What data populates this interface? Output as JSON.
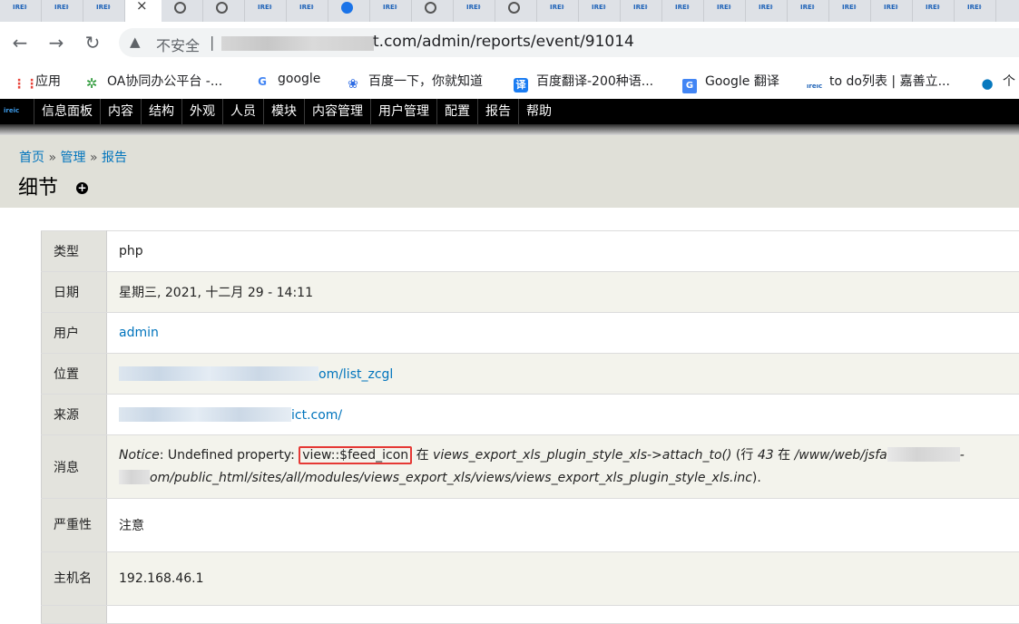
{
  "browser": {
    "tab_favicon_text": "IREIC",
    "tab_close_glyph": "×",
    "nav": {
      "back": "←",
      "forward": "→",
      "reload": "↻"
    },
    "address": {
      "warning_icon": "▲",
      "insecure_label": "不安全",
      "separator": "|",
      "url_visible": "t.com/admin/reports/event/91014"
    },
    "bookmarks": [
      {
        "icon": "apps-grid-icon",
        "label": "应用"
      },
      {
        "icon": "oa-icon",
        "label": "OA协同办公平台 -..."
      },
      {
        "icon": "google-icon",
        "label": "google"
      },
      {
        "icon": "baidu-icon",
        "label": "百度一下，你就知道"
      },
      {
        "icon": "translate-icon",
        "label": "百度翻译-200种语..."
      },
      {
        "icon": "google-translate-icon",
        "label": "Google 翻译"
      },
      {
        "icon": "ireic-icon",
        "label": "to do列表 | 嘉善立..."
      },
      {
        "icon": "drupal-icon",
        "label": "个"
      }
    ]
  },
  "admin_menu": {
    "logo": "ireic",
    "items": [
      "信息面板",
      "内容",
      "结构",
      "外观",
      "人员",
      "模块",
      "内容管理",
      "用户管理",
      "配置",
      "报告",
      "帮助"
    ]
  },
  "breadcrumb": {
    "home": "首页",
    "admin": "管理",
    "reports": "报告",
    "sep": "»"
  },
  "page_title": "细节",
  "details": {
    "type_label": "类型",
    "type_value": "php",
    "date_label": "日期",
    "date_value": "星期三, 2021, 十二月 29 - 14:11",
    "user_label": "用户",
    "user_value": "admin",
    "location_label": "位置",
    "location_value_suffix": "om/list_zcgl",
    "referrer_label": "来源",
    "referrer_value_suffix": "ict.com/",
    "message_label": "消息",
    "message": {
      "notice": "Notice",
      "text1": ": Undefined property: ",
      "highlight": "view::$feed_icon",
      "in1": " 在 ",
      "func": "views_export_xls_plugin_style_xls->attach_to()",
      "line_open": " (行 ",
      "line_no": "43",
      "in2": " 在 ",
      "path_start": "/www/web/jsfa",
      "path_dash": "-",
      "path_rest": "om/public_html/sites/all/modules/views_export_xls/views/views_export_xls_plugin_style_xls.inc",
      "close": ")."
    },
    "severity_label": "严重性",
    "severity_value": "注意",
    "host_label": "主机名",
    "host_value": "192.168.46.1"
  }
}
